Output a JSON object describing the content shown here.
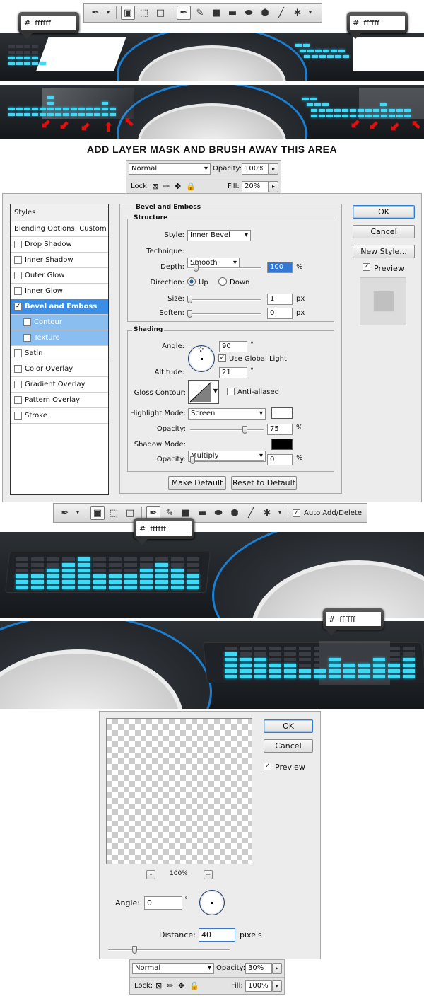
{
  "hex": {
    "prefix": "#",
    "value": "ffffff"
  },
  "caption": "ADD LAYER MASK AND BRUSH AWAY THIS AREA",
  "layers_top": {
    "blend_mode": "Normal",
    "opacity_label": "Opacity:",
    "opacity": "100%",
    "lock_label": "Lock:",
    "fill_label": "Fill:",
    "fill": "20%"
  },
  "layers_bottom": {
    "blend_mode": "Normal",
    "opacity_label": "Opacity:",
    "opacity": "30%",
    "lock_label": "Lock:",
    "fill_label": "Fill:",
    "fill": "100%"
  },
  "layer_style": {
    "styles_header": "Styles",
    "items": [
      {
        "label": "Blending Options: Custom",
        "check": false,
        "sub": false,
        "selected": false
      },
      {
        "label": "Drop Shadow",
        "check": true,
        "checked": false
      },
      {
        "label": "Inner Shadow",
        "check": true,
        "checked": false
      },
      {
        "label": "Outer Glow",
        "check": true,
        "checked": false
      },
      {
        "label": "Inner Glow",
        "check": true,
        "checked": false
      },
      {
        "label": "Bevel and Emboss",
        "check": true,
        "checked": true,
        "selected": true
      },
      {
        "label": "Contour",
        "check": true,
        "checked": false,
        "sub": true
      },
      {
        "label": "Texture",
        "check": true,
        "checked": false,
        "sub": true
      },
      {
        "label": "Satin",
        "check": true,
        "checked": false
      },
      {
        "label": "Color Overlay",
        "check": true,
        "checked": false
      },
      {
        "label": "Gradient Overlay",
        "check": true,
        "checked": false
      },
      {
        "label": "Pattern Overlay",
        "check": true,
        "checked": false
      },
      {
        "label": "Stroke",
        "check": true,
        "checked": false
      }
    ],
    "section_title": "Bevel and Emboss",
    "structure_title": "Structure",
    "style_label": "Style:",
    "style_value": "Inner Bevel",
    "technique_label": "Technique:",
    "technique_value": "Smooth",
    "depth_label": "Depth:",
    "depth_value": "100",
    "depth_unit": "%",
    "direction_label": "Direction:",
    "dir_up": "Up",
    "dir_down": "Down",
    "size_label": "Size:",
    "size_value": "1",
    "size_unit": "px",
    "soften_label": "Soften:",
    "soften_value": "0",
    "soften_unit": "px",
    "shading_title": "Shading",
    "angle_label": "Angle:",
    "angle_value": "90",
    "angle_unit": "°",
    "global_light": "Use Global Light",
    "altitude_label": "Altitude:",
    "altitude_value": "21",
    "altitude_unit": "°",
    "gloss_label": "Gloss Contour:",
    "anti_aliased": "Anti-aliased",
    "highlight_label": "Highlight Mode:",
    "highlight_value": "Screen",
    "hl_opacity_label": "Opacity:",
    "hl_opacity_value": "75",
    "hl_opacity_unit": "%",
    "shadow_label": "Shadow Mode:",
    "shadow_value": "Multiply",
    "sh_opacity_label": "Opacity:",
    "sh_opacity_value": "0",
    "sh_opacity_unit": "%",
    "make_default": "Make Default",
    "reset_default": "Reset to Default",
    "ok": "OK",
    "cancel": "Cancel",
    "new_style": "New Style...",
    "preview": "Preview",
    "highlight_color": "#ffffff",
    "shadow_color": "#000000"
  },
  "toolbar2": {
    "auto_add": "Auto Add/Delete"
  },
  "motion_blur": {
    "ok": "OK",
    "cancel": "Cancel",
    "preview": "Preview",
    "zoom": "100%",
    "zoom_minus": "-",
    "zoom_plus": "+",
    "angle_label": "Angle:",
    "angle_value": "0",
    "angle_unit": "°",
    "distance_label": "Distance:",
    "distance_value": "40",
    "distance_unit": "pixels"
  }
}
